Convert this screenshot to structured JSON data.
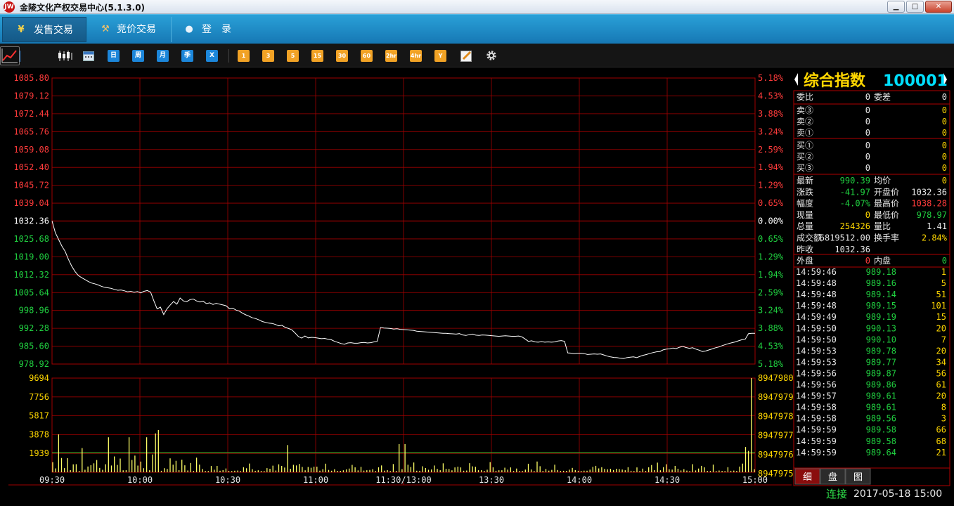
{
  "window": {
    "title": "金陵文化产权交易中心(5.1.3.0)",
    "logo": "logo-icon"
  },
  "nav": {
    "tabs": [
      {
        "label": "发售交易",
        "icon": "yen-icon",
        "active": true
      },
      {
        "label": "竞价交易",
        "icon": "gavel-icon",
        "active": false
      },
      {
        "label": "登录",
        "icon": "user-icon",
        "active": false
      }
    ]
  },
  "toolbar": {
    "period_buttons": [
      "日",
      "周",
      "月",
      "季",
      "X"
    ],
    "minute_buttons": [
      "1",
      "3",
      "5",
      "15",
      "30",
      "60",
      "2hr",
      "4hr",
      "Y"
    ]
  },
  "colors": {
    "up": "#ff3b3b",
    "down": "#20d040",
    "flat": "#ffffff",
    "grid": "#a00000",
    "accent": "#ffd700",
    "code": "#00e0ff"
  },
  "chart_data": {
    "type": "line",
    "price_ticks": [
      "1085.80",
      "1079.12",
      "1072.44",
      "1065.76",
      "1059.08",
      "1052.40",
      "1045.72",
      "1039.04",
      "1032.36",
      "1025.68",
      "1019.00",
      "1012.32",
      "1005.64",
      "998.96",
      "992.28",
      "985.60",
      "978.92"
    ],
    "percent_ticks": [
      "5.18%",
      "4.53%",
      "3.88%",
      "3.24%",
      "2.59%",
      "1.94%",
      "1.29%",
      "0.65%",
      "0.00%",
      "0.65%",
      "1.29%",
      "1.94%",
      "2.59%",
      "3.24%",
      "3.88%",
      "4.53%",
      "5.18%"
    ],
    "volume_ticks_left": [
      "9694",
      "7756",
      "5817",
      "3878",
      "1939"
    ],
    "volume_ticks_right": [
      "8947980",
      "8947979",
      "8947978",
      "8947977",
      "8947976",
      "8947975"
    ],
    "time_labels": [
      "09:30",
      "10:00",
      "10:30",
      "11:00",
      "11:30/13:00",
      "13:30",
      "14:00",
      "14:30",
      "15:00"
    ],
    "ylim": [
      978.92,
      1085.8
    ],
    "prev_close": 1032.36,
    "price": [
      1032.4,
      1028,
      1025.5,
      1023,
      1021,
      1018,
      1015.5,
      1013.5,
      1012,
      1011.2,
      1010.5,
      1009.8,
      1009.2,
      1008.9,
      1008.5,
      1008,
      1007.6,
      1007.4,
      1007.2,
      1006.8,
      1006.5,
      1006.6,
      1006.3,
      1005.9,
      1006.1,
      1005.7,
      1006,
      1005.5,
      1006.1,
      1006.4,
      1005.8,
      1002.5,
      999.5,
      1000.2,
      997.4,
      999.6,
      1001,
      1002.3,
      1001.3,
      1003.6,
      1002.5,
      1002.2,
      1003,
      1003.2,
      1002.5,
      1002.1,
      1002.4,
      1001.5,
      1001.8,
      1001.2,
      1001.6,
      1001.3,
      1001,
      1000.7,
      999.6,
      999.8,
      999.1,
      998.7,
      997.9,
      997.3,
      996.8,
      996.2,
      995.9,
      995.4,
      994.8,
      994.5,
      994.2,
      994.1,
      993.7,
      993.2,
      993.4,
      992.6,
      992.2,
      991.7,
      990.5,
      989.2,
      988.6,
      989.4,
      988.7,
      988.9,
      988.8,
      988.6,
      988.4,
      988.5,
      988.2,
      988,
      987.4,
      987,
      986.6,
      986.3,
      986.8,
      986.9,
      986.7,
      986.7,
      986.9,
      987,
      986.8,
      986.9,
      987.2,
      987.4,
      992.6,
      992.4,
      992.3,
      992.2,
      992,
      992.1,
      991.9,
      991.8,
      991.7,
      991.6,
      991.5,
      991.2,
      991.1,
      991,
      990.9,
      990.8,
      990.7,
      990.6,
      990.5,
      990.4,
      990.4,
      990.3,
      990.2,
      990.1,
      990.3,
      989.8,
      989.6,
      989.9,
      990.1,
      989.7,
      989.6,
      989.8,
      989.7,
      989.6,
      989.5,
      989.4,
      989.3,
      989.4,
      989.5,
      989.4,
      989.3,
      989.3,
      989.4,
      989.1,
      988.3,
      987.4,
      987.6,
      987.2,
      987.1,
      987.3,
      987.1,
      987.2,
      987.1,
      987.2,
      987.5,
      987.7,
      987.4,
      983.1,
      983,
      982.8,
      982.9,
      983,
      982.8,
      982.5,
      982.6,
      982.7,
      982.6,
      982.7,
      982.3,
      981.9,
      981.6,
      981.4,
      981.3,
      981.1,
      981,
      981.3,
      981.5,
      981.6,
      981.3,
      981.8,
      982.2,
      982.5,
      982.9,
      983.2,
      983.5,
      983.6,
      984.2,
      984.5,
      984.6,
      984.9,
      984.7,
      985.2,
      985.5,
      985.1,
      984.8,
      985,
      984.5,
      984.1,
      983.6,
      983.8,
      984.2,
      984.6,
      985,
      985.3,
      985.8,
      986.2,
      986.6,
      986.9,
      987.2,
      987.6,
      988,
      988.2,
      990.3,
      990.4,
      990.39
    ],
    "volume_spikes": [
      9694,
      4200,
      1500
    ],
    "series": []
  },
  "quote": {
    "title": "综合指数",
    "code": "100001",
    "order_ratio": {
      "label": "委比",
      "value": "0"
    },
    "order_diff": {
      "label": "委差",
      "value": "0"
    },
    "asks": [
      {
        "label": "卖③",
        "price": "0",
        "vol": "0"
      },
      {
        "label": "卖②",
        "price": "0",
        "vol": "0"
      },
      {
        "label": "卖①",
        "price": "0",
        "vol": "0"
      }
    ],
    "bids": [
      {
        "label": "买①",
        "price": "0",
        "vol": "0"
      },
      {
        "label": "买②",
        "price": "0",
        "vol": "0"
      },
      {
        "label": "买③",
        "price": "0",
        "vol": "0"
      }
    ],
    "stats": [
      {
        "l1": "最新",
        "v1": "990.39",
        "l2": "均价",
        "v2": "0"
      },
      {
        "l1": "涨跌",
        "v1": "-41.97",
        "l2": "开盘价",
        "v2": "1032.36"
      },
      {
        "l1": "幅度",
        "v1": "-4.07%",
        "l2": "最高价",
        "v2": "1038.28"
      },
      {
        "l1": "现量",
        "v1": "0",
        "l2": "最低价",
        "v2": "978.97"
      },
      {
        "l1": "总量",
        "v1": "254326",
        "l2": "量比",
        "v2": "1.41"
      },
      {
        "l1": "成交额",
        "v1": "6819512.00",
        "l2": "换手率",
        "v2": "2.84%"
      },
      {
        "l1": "昨收",
        "v1": "1032.36",
        "l2": "",
        "v2": ""
      }
    ],
    "outer": {
      "label": "外盘",
      "value": "0"
    },
    "inner": {
      "label": "内盘",
      "value": "0"
    },
    "ticks": [
      {
        "time": "14:59:46",
        "price": "989.18",
        "vol": "1"
      },
      {
        "time": "14:59:48",
        "price": "989.16",
        "vol": "5"
      },
      {
        "time": "14:59:48",
        "price": "989.14",
        "vol": "51"
      },
      {
        "time": "14:59:48",
        "price": "989.15",
        "vol": "101"
      },
      {
        "time": "14:59:49",
        "price": "989.19",
        "vol": "15"
      },
      {
        "time": "14:59:50",
        "price": "990.13",
        "vol": "20"
      },
      {
        "time": "14:59:50",
        "price": "990.10",
        "vol": "7"
      },
      {
        "time": "14:59:53",
        "price": "989.78",
        "vol": "20"
      },
      {
        "time": "14:59:53",
        "price": "989.77",
        "vol": "34"
      },
      {
        "time": "14:59:56",
        "price": "989.87",
        "vol": "56"
      },
      {
        "time": "14:59:56",
        "price": "989.86",
        "vol": "61"
      },
      {
        "time": "14:59:57",
        "price": "989.61",
        "vol": "20"
      },
      {
        "time": "14:59:58",
        "price": "989.61",
        "vol": "8"
      },
      {
        "time": "14:59:58",
        "price": "989.56",
        "vol": "3"
      },
      {
        "time": "14:59:59",
        "price": "989.58",
        "vol": "66"
      },
      {
        "time": "14:59:59",
        "price": "989.58",
        "vol": "68"
      },
      {
        "time": "14:59:59",
        "price": "989.64",
        "vol": "21"
      }
    ],
    "tabs": [
      "细",
      "盘",
      "图"
    ]
  },
  "status": {
    "connection": "连接",
    "datetime": "2017-05-18 15:00"
  }
}
